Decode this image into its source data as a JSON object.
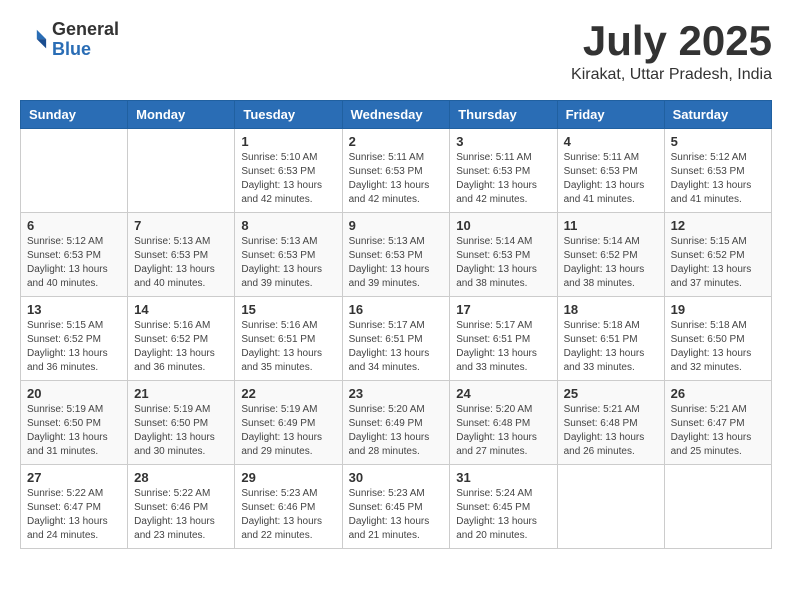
{
  "logo": {
    "text_general": "General",
    "text_blue": "Blue"
  },
  "header": {
    "month_year": "July 2025",
    "location": "Kirakat, Uttar Pradesh, India"
  },
  "weekdays": [
    "Sunday",
    "Monday",
    "Tuesday",
    "Wednesday",
    "Thursday",
    "Friday",
    "Saturday"
  ],
  "weeks": [
    [
      {
        "day": "",
        "info": ""
      },
      {
        "day": "",
        "info": ""
      },
      {
        "day": "1",
        "info": "Sunrise: 5:10 AM\nSunset: 6:53 PM\nDaylight: 13 hours and 42 minutes."
      },
      {
        "day": "2",
        "info": "Sunrise: 5:11 AM\nSunset: 6:53 PM\nDaylight: 13 hours and 42 minutes."
      },
      {
        "day": "3",
        "info": "Sunrise: 5:11 AM\nSunset: 6:53 PM\nDaylight: 13 hours and 42 minutes."
      },
      {
        "day": "4",
        "info": "Sunrise: 5:11 AM\nSunset: 6:53 PM\nDaylight: 13 hours and 41 minutes."
      },
      {
        "day": "5",
        "info": "Sunrise: 5:12 AM\nSunset: 6:53 PM\nDaylight: 13 hours and 41 minutes."
      }
    ],
    [
      {
        "day": "6",
        "info": "Sunrise: 5:12 AM\nSunset: 6:53 PM\nDaylight: 13 hours and 40 minutes."
      },
      {
        "day": "7",
        "info": "Sunrise: 5:13 AM\nSunset: 6:53 PM\nDaylight: 13 hours and 40 minutes."
      },
      {
        "day": "8",
        "info": "Sunrise: 5:13 AM\nSunset: 6:53 PM\nDaylight: 13 hours and 39 minutes."
      },
      {
        "day": "9",
        "info": "Sunrise: 5:13 AM\nSunset: 6:53 PM\nDaylight: 13 hours and 39 minutes."
      },
      {
        "day": "10",
        "info": "Sunrise: 5:14 AM\nSunset: 6:53 PM\nDaylight: 13 hours and 38 minutes."
      },
      {
        "day": "11",
        "info": "Sunrise: 5:14 AM\nSunset: 6:52 PM\nDaylight: 13 hours and 38 minutes."
      },
      {
        "day": "12",
        "info": "Sunrise: 5:15 AM\nSunset: 6:52 PM\nDaylight: 13 hours and 37 minutes."
      }
    ],
    [
      {
        "day": "13",
        "info": "Sunrise: 5:15 AM\nSunset: 6:52 PM\nDaylight: 13 hours and 36 minutes."
      },
      {
        "day": "14",
        "info": "Sunrise: 5:16 AM\nSunset: 6:52 PM\nDaylight: 13 hours and 36 minutes."
      },
      {
        "day": "15",
        "info": "Sunrise: 5:16 AM\nSunset: 6:51 PM\nDaylight: 13 hours and 35 minutes."
      },
      {
        "day": "16",
        "info": "Sunrise: 5:17 AM\nSunset: 6:51 PM\nDaylight: 13 hours and 34 minutes."
      },
      {
        "day": "17",
        "info": "Sunrise: 5:17 AM\nSunset: 6:51 PM\nDaylight: 13 hours and 33 minutes."
      },
      {
        "day": "18",
        "info": "Sunrise: 5:18 AM\nSunset: 6:51 PM\nDaylight: 13 hours and 33 minutes."
      },
      {
        "day": "19",
        "info": "Sunrise: 5:18 AM\nSunset: 6:50 PM\nDaylight: 13 hours and 32 minutes."
      }
    ],
    [
      {
        "day": "20",
        "info": "Sunrise: 5:19 AM\nSunset: 6:50 PM\nDaylight: 13 hours and 31 minutes."
      },
      {
        "day": "21",
        "info": "Sunrise: 5:19 AM\nSunset: 6:50 PM\nDaylight: 13 hours and 30 minutes."
      },
      {
        "day": "22",
        "info": "Sunrise: 5:19 AM\nSunset: 6:49 PM\nDaylight: 13 hours and 29 minutes."
      },
      {
        "day": "23",
        "info": "Sunrise: 5:20 AM\nSunset: 6:49 PM\nDaylight: 13 hours and 28 minutes."
      },
      {
        "day": "24",
        "info": "Sunrise: 5:20 AM\nSunset: 6:48 PM\nDaylight: 13 hours and 27 minutes."
      },
      {
        "day": "25",
        "info": "Sunrise: 5:21 AM\nSunset: 6:48 PM\nDaylight: 13 hours and 26 minutes."
      },
      {
        "day": "26",
        "info": "Sunrise: 5:21 AM\nSunset: 6:47 PM\nDaylight: 13 hours and 25 minutes."
      }
    ],
    [
      {
        "day": "27",
        "info": "Sunrise: 5:22 AM\nSunset: 6:47 PM\nDaylight: 13 hours and 24 minutes."
      },
      {
        "day": "28",
        "info": "Sunrise: 5:22 AM\nSunset: 6:46 PM\nDaylight: 13 hours and 23 minutes."
      },
      {
        "day": "29",
        "info": "Sunrise: 5:23 AM\nSunset: 6:46 PM\nDaylight: 13 hours and 22 minutes."
      },
      {
        "day": "30",
        "info": "Sunrise: 5:23 AM\nSunset: 6:45 PM\nDaylight: 13 hours and 21 minutes."
      },
      {
        "day": "31",
        "info": "Sunrise: 5:24 AM\nSunset: 6:45 PM\nDaylight: 13 hours and 20 minutes."
      },
      {
        "day": "",
        "info": ""
      },
      {
        "day": "",
        "info": ""
      }
    ]
  ]
}
